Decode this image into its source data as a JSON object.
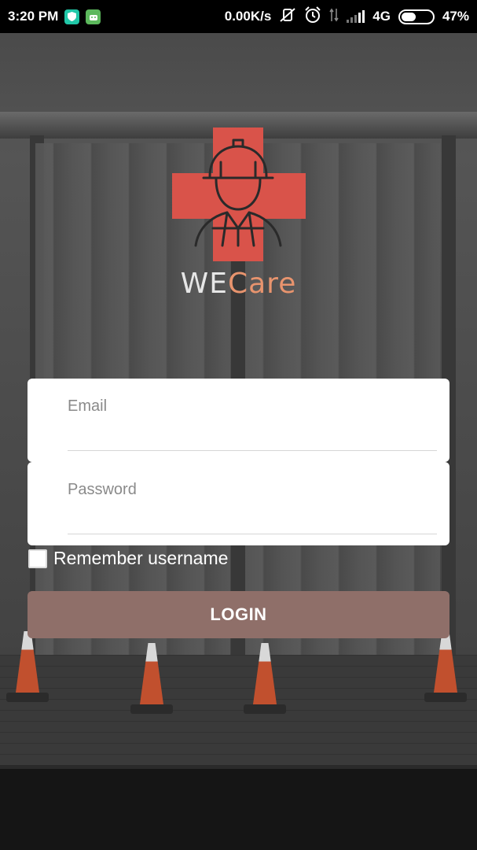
{
  "status_bar": {
    "time": "3:20 PM",
    "speed": "0.00K/s",
    "network": "4G",
    "battery": "47%",
    "battery_level": 0.47,
    "icons": [
      "shield-app-icon",
      "android-app-icon",
      "vibrate-off-icon",
      "alarm-icon",
      "data-arrows-icon",
      "signal-icon",
      "battery-icon"
    ]
  },
  "brand": {
    "name_part1": "WE",
    "name_part2": "Care",
    "accent_color": "#d9534a",
    "care_color": "#e8946e"
  },
  "form": {
    "email_label": "Email",
    "email_value": "",
    "password_label": "Password",
    "password_value": "",
    "remember_label": "Remember username",
    "remember_checked": false,
    "login_label": "LOGIN",
    "login_color": "#8f6f69"
  }
}
